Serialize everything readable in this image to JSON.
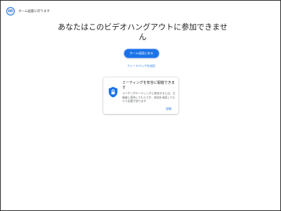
{
  "topbar": {
    "avatar_text": "HO",
    "back_link": "ホーム画面に戻ります"
  },
  "main": {
    "title": "あなたはこのビデオハングアウトに参加できません",
    "home_button": "ホーム画面に戻る",
    "feedback_link": "フィードバックを送信"
  },
  "security_card": {
    "icon": "shield-lock-icon",
    "title": "ミーティングを安全に開催できます",
    "body": "ユーザーがミーティングに参加するには、主催者に招待してもらうか、参加を承認してもらう必要があります",
    "link": "詳細"
  },
  "colors": {
    "accent": "#1a73e8",
    "text": "#202124",
    "muted": "#5f6368"
  }
}
